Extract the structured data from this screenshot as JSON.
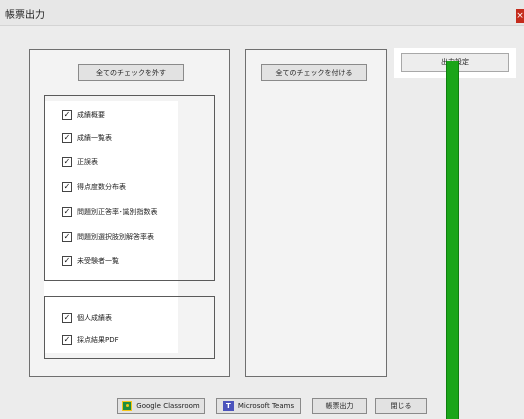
{
  "window": {
    "title": "帳票出力",
    "close_glyph": "×"
  },
  "left_panel": {
    "uncheck_all_label": "全てのチェックを外す",
    "group1_items": [
      {
        "label": "成績概要",
        "checked": true
      },
      {
        "label": "成績一覧表",
        "checked": true
      },
      {
        "label": "正誤表",
        "checked": true
      },
      {
        "label": "得点度数分布表",
        "checked": true
      },
      {
        "label": "問題別正答率･識別指数表",
        "checked": true
      },
      {
        "label": "問題別選択肢別解答率表",
        "checked": true
      },
      {
        "label": "未受験者一覧",
        "checked": true
      }
    ],
    "group2_items": [
      {
        "label": "個人成績表",
        "checked": true
      },
      {
        "label": "採点結果PDF",
        "checked": true
      }
    ]
  },
  "middle_panel": {
    "check_all_label": "全てのチェックを付ける"
  },
  "settings_button": {
    "label": "出力設定"
  },
  "bottom_buttons": {
    "google_classroom": "Google Classroom",
    "microsoft_teams": "Microsoft Teams",
    "output": "帳票出力",
    "close": "閉じる"
  },
  "check_glyph": "✓"
}
